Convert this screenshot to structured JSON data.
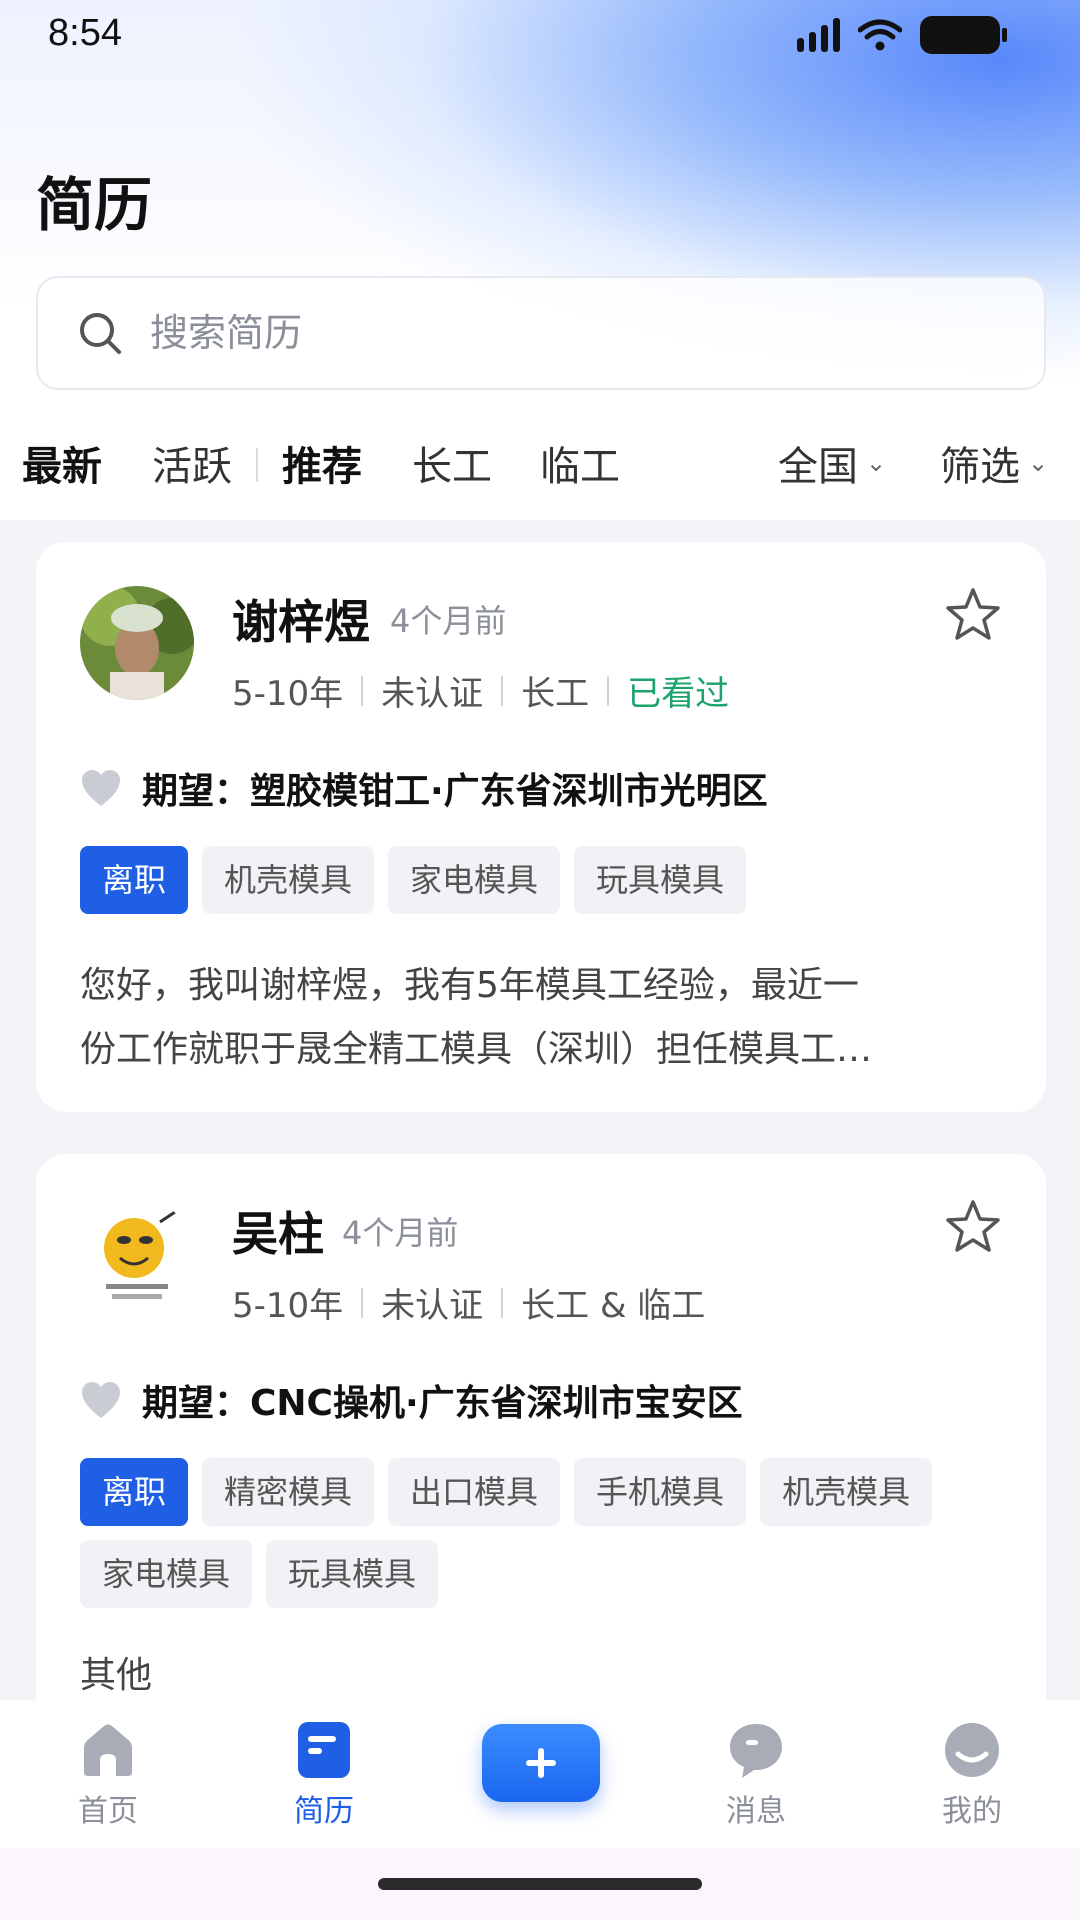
{
  "status_bar": {
    "time": "8:54"
  },
  "header": {
    "title": "简历"
  },
  "search": {
    "placeholder": "搜索简历"
  },
  "tabs": [
    {
      "label": "最新",
      "active": true
    },
    {
      "label": "活跃",
      "active": false
    },
    {
      "label": "推荐",
      "active": true
    },
    {
      "label": "长工",
      "active": false
    },
    {
      "label": "临工",
      "active": false
    }
  ],
  "filters": {
    "region": "全国",
    "filter": "筛选"
  },
  "cards": [
    {
      "name": "谢梓煜",
      "time": "4个月前",
      "meta": [
        "5-10年",
        "未认证",
        "长工"
      ],
      "seen": "已看过",
      "expect": "期望：塑胶模钳工·广东省深圳市光明区",
      "tags": [
        "离职",
        "机壳模具",
        "家电模具",
        "玩具模具"
      ],
      "intro_line1": "您好，我叫谢梓煜，我有5年模具工经验，最近一",
      "intro_line2": "份工作就职于晟全精工模具（深圳）担任模具工…"
    },
    {
      "name": "吴柱",
      "time": "4个月前",
      "meta": [
        "5-10年",
        "未认证",
        "长工 & 临工"
      ],
      "expect": "期望：CNC操机·广东省深圳市宝安区",
      "tags": [
        "离职",
        "精密模具",
        "出口模具",
        "手机模具",
        "机壳模具",
        "家电模具",
        "玩具模具"
      ],
      "intro_line1": "其他"
    }
  ],
  "bottom_nav": {
    "items": [
      {
        "label": "首页",
        "icon": "home-icon"
      },
      {
        "label": "简历",
        "icon": "resume-icon"
      },
      {
        "label": "消息",
        "icon": "message-icon"
      },
      {
        "label": "我的",
        "icon": "profile-icon"
      }
    ]
  },
  "colors": {
    "primary": "#1f5fe6",
    "seen": "#1aa36b"
  }
}
